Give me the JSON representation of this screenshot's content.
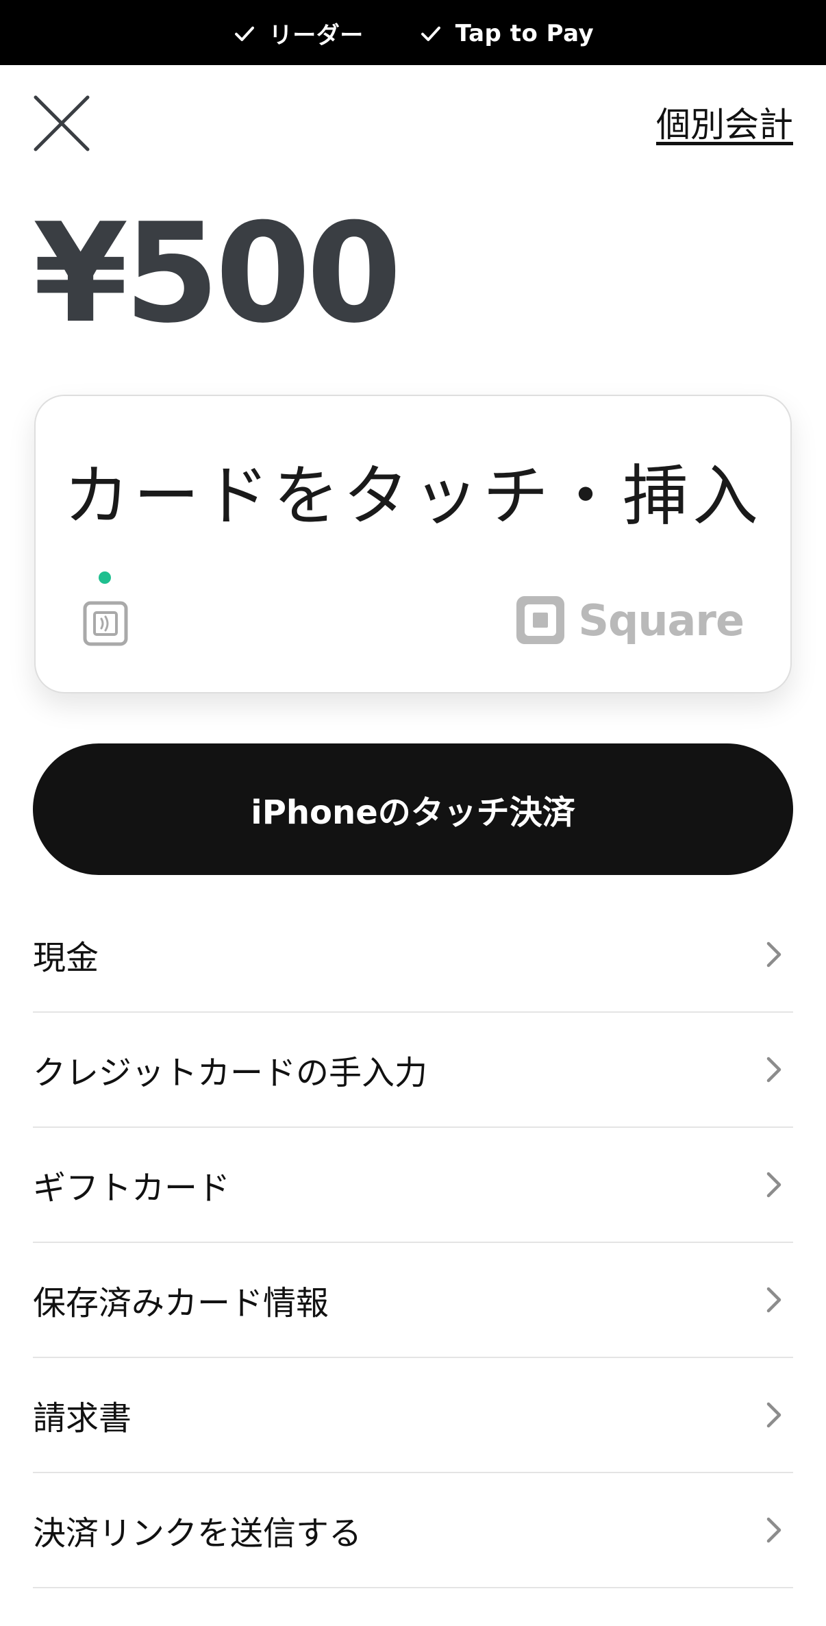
{
  "status_bar": {
    "items": [
      {
        "label": "リーダー",
        "icon": "check-icon"
      },
      {
        "label": "Tap to Pay",
        "icon": "check-icon"
      }
    ]
  },
  "header": {
    "close_icon": "close-icon",
    "split_label": "個別会計"
  },
  "amount": "¥500",
  "reader_card": {
    "prompt": "カードをタッチ・挿入",
    "status_color": "#1fbf8f",
    "brand": "Square"
  },
  "tap_to_pay_button": "iPhoneのタッチ決済",
  "payment_options": [
    {
      "label": "現金"
    },
    {
      "label": "クレジットカードの手入力"
    },
    {
      "label": "ギフトカード"
    },
    {
      "label": "保存済みカード情報"
    },
    {
      "label": "請求書"
    },
    {
      "label": "決済リンクを送信する"
    }
  ]
}
